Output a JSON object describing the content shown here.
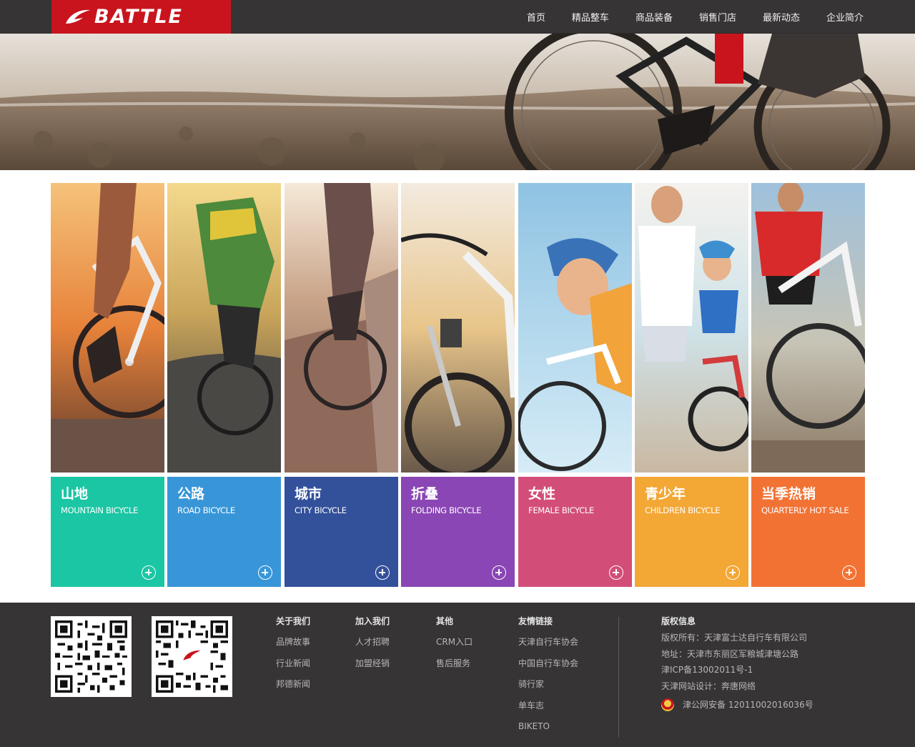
{
  "header": {
    "logo_text": "BATTLE",
    "nav": [
      "首页",
      "精品整车",
      "商品装备",
      "销售门店",
      "最新动态",
      "企业简介"
    ]
  },
  "categories": [
    {
      "title": "山地",
      "subtitle": "MOUNTAIN BICYCLE",
      "color": "#1bc6a4"
    },
    {
      "title": "公路",
      "subtitle": "ROAD BICYCLE",
      "color": "#3896d8"
    },
    {
      "title": "城市",
      "subtitle": "CITY BICYCLE",
      "color": "#33509a"
    },
    {
      "title": "折叠",
      "subtitle": "FOLDING BICYCLE",
      "color": "#8a46b4"
    },
    {
      "title": "女性",
      "subtitle": "FEMALE BICYCLE",
      "color": "#d24e78"
    },
    {
      "title": "青少年",
      "subtitle": "CHILDREN BICYCLE",
      "color": "#f3a735"
    },
    {
      "title": "当季热销",
      "subtitle": "QUARTERLY HOT SALE",
      "color": "#f27234"
    }
  ],
  "footer": {
    "about": {
      "heading": "关于我们",
      "links": [
        "品牌故事",
        "行业新闻",
        "邦德新闻"
      ]
    },
    "join": {
      "heading": "加入我们",
      "links": [
        "人才招聘",
        "加盟经销"
      ]
    },
    "other": {
      "heading": "其他",
      "links": [
        "CRM入口",
        "售后服务"
      ]
    },
    "friends": {
      "heading": "友情链接",
      "links": [
        "天津自行车协会",
        "中国自行车协会",
        "骑行家",
        "单车志",
        "BIKETO"
      ]
    },
    "copyright": {
      "heading": "版权信息",
      "lines": [
        "版权所有：天津富士达自行车有限公司",
        "地址：天津市东丽区军粮城津塘公路",
        "津ICP备13002011号-1",
        "天津网站设计：奔唐网络"
      ],
      "police": "津公网安备 12011002016036号"
    }
  }
}
